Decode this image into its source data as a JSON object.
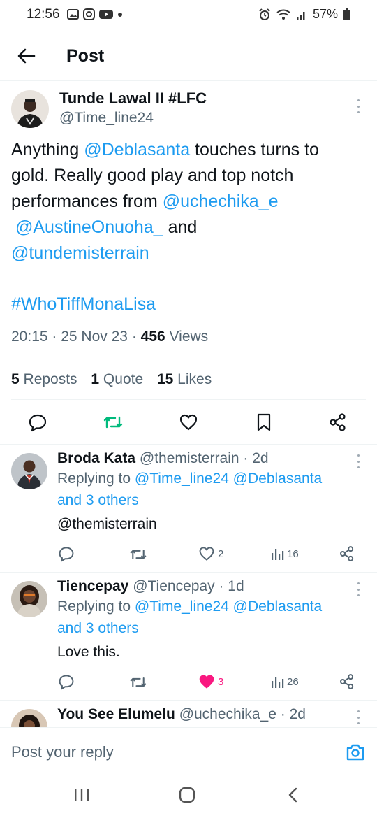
{
  "status_bar": {
    "time": "12:56",
    "battery": "57%"
  },
  "header": {
    "title": "Post"
  },
  "tweet": {
    "display_name": "Tunde Lawal II #LFC",
    "handle": "@Time_line24",
    "body": {
      "p1": "Anything ",
      "m1": "@Deblasanta",
      "p2": " touches turns to gold. Really good play and top notch performances from ",
      "m2": "@uchechika_e",
      "m3": "@AustineOnuoha_",
      "p3": " and ",
      "m4": "@tundemisterrain",
      "hashtag": "#WhoTiffMonaLisa"
    },
    "time": "20:15",
    "date": "25 Nov 23",
    "views_count": "456",
    "views_label": " Views",
    "reposts_count": "5",
    "reposts_label": " Reposts",
    "quotes_count": "1",
    "quotes_label": " Quote",
    "likes_count": "15",
    "likes_label": " Likes"
  },
  "replies": [
    {
      "display_name": "Broda Kata",
      "handle": "@themisterrain",
      "age": "2d",
      "replying_prefix": "Replying to ",
      "replying_to": "@Time_line24 @Deblasanta",
      "others": "and 3 others",
      "text": "@themisterrain",
      "text_is_mention": true,
      "likes": "2",
      "views": "16",
      "liked": false
    },
    {
      "display_name": "Tiencepay",
      "handle": "@Tiencepay",
      "age": "1d",
      "replying_prefix": "Replying to ",
      "replying_to": "@Time_line24 @Deblasanta",
      "others": "and 3 others",
      "text": "Love this.",
      "text_is_mention": false,
      "likes": "3",
      "views": "26",
      "liked": true
    },
    {
      "display_name": "You See Elumelu",
      "handle": "@uchechika_e",
      "age": "2d"
    }
  ],
  "reply_bar": {
    "placeholder": "Post your reply"
  },
  "colors": {
    "accent": "#1d9bf0",
    "repost_green": "#00ba7c",
    "like_pink": "#f91880",
    "muted": "#536471"
  },
  "icons": [
    "back-arrow-icon",
    "more-icon",
    "reply-icon",
    "repost-icon",
    "like-icon",
    "bookmark-icon",
    "share-icon",
    "views-icon",
    "camera-icon"
  ]
}
